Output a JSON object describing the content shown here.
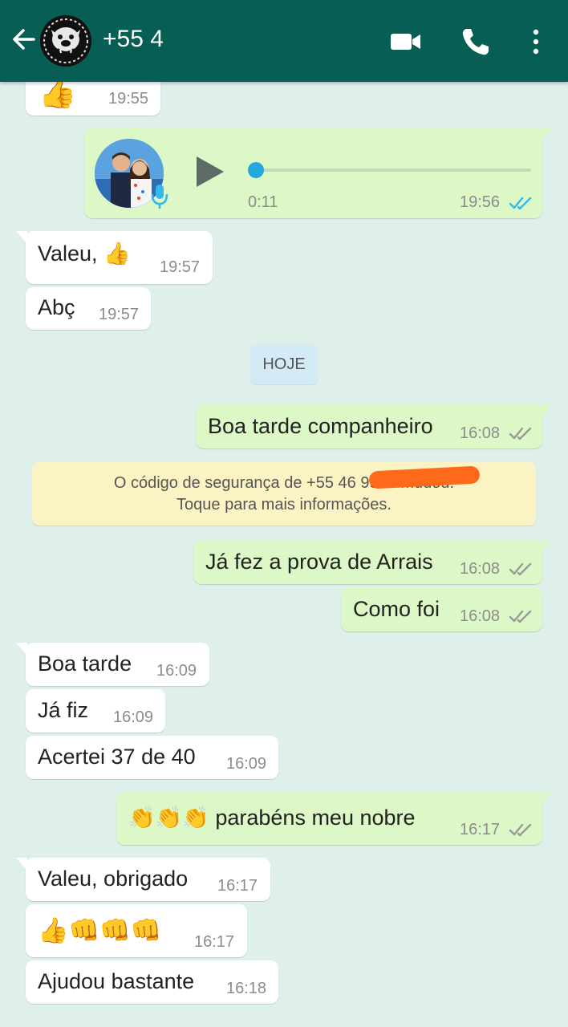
{
  "header": {
    "contact_name": "+55 4",
    "icons": [
      "back-arrow-icon",
      "video-call-icon",
      "voice-call-icon",
      "more-options-icon"
    ],
    "bg_color": "#075e54"
  },
  "messages": [
    {
      "dir": "in",
      "text": "",
      "emoji": "👍",
      "time": "19:55"
    },
    {
      "dir": "out",
      "type": "voice",
      "duration": "0:11",
      "time": "19:56",
      "status": "read"
    },
    {
      "dir": "in",
      "text": "Valeu, 👍",
      "time": "19:57"
    },
    {
      "dir": "in",
      "text": "Abç",
      "time": "19:57"
    },
    {
      "dir": "out",
      "text": "Boa tarde companheiro",
      "time": "16:08",
      "status": "delivered"
    },
    {
      "dir": "out",
      "text": "Já fez a prova de Arrais",
      "time": "16:08",
      "status": "delivered"
    },
    {
      "dir": "out",
      "text": "Como foi",
      "time": "16:08",
      "status": "delivered"
    },
    {
      "dir": "in",
      "text": "Boa tarde",
      "time": "16:09"
    },
    {
      "dir": "in",
      "text": "Já fiz",
      "time": "16:09"
    },
    {
      "dir": "in",
      "text": "Acertei 37 de 40",
      "time": "16:09"
    },
    {
      "dir": "out",
      "text": "👏👏👏 parabéns meu nobre",
      "time": "16:17",
      "status": "delivered"
    },
    {
      "dir": "in",
      "text": "Valeu, obrigado",
      "time": "16:17"
    },
    {
      "dir": "in",
      "text": "👍👊👊👊",
      "time": "16:17"
    },
    {
      "dir": "in",
      "text": "Ajudou bastante",
      "time": "16:18"
    }
  ],
  "day_separator": "HOJE",
  "security_notice": {
    "line1_start": "O código de segurança de +55 46 9929",
    "line1_end": "mudou.",
    "line2": "Toque para mais informações."
  },
  "colors": {
    "incoming": "#ffffff",
    "outgoing": "#dcf8c6",
    "background": "#dff0ea",
    "read_ticks": "#34b7f1",
    "voice_progress": "#25a8e0"
  }
}
